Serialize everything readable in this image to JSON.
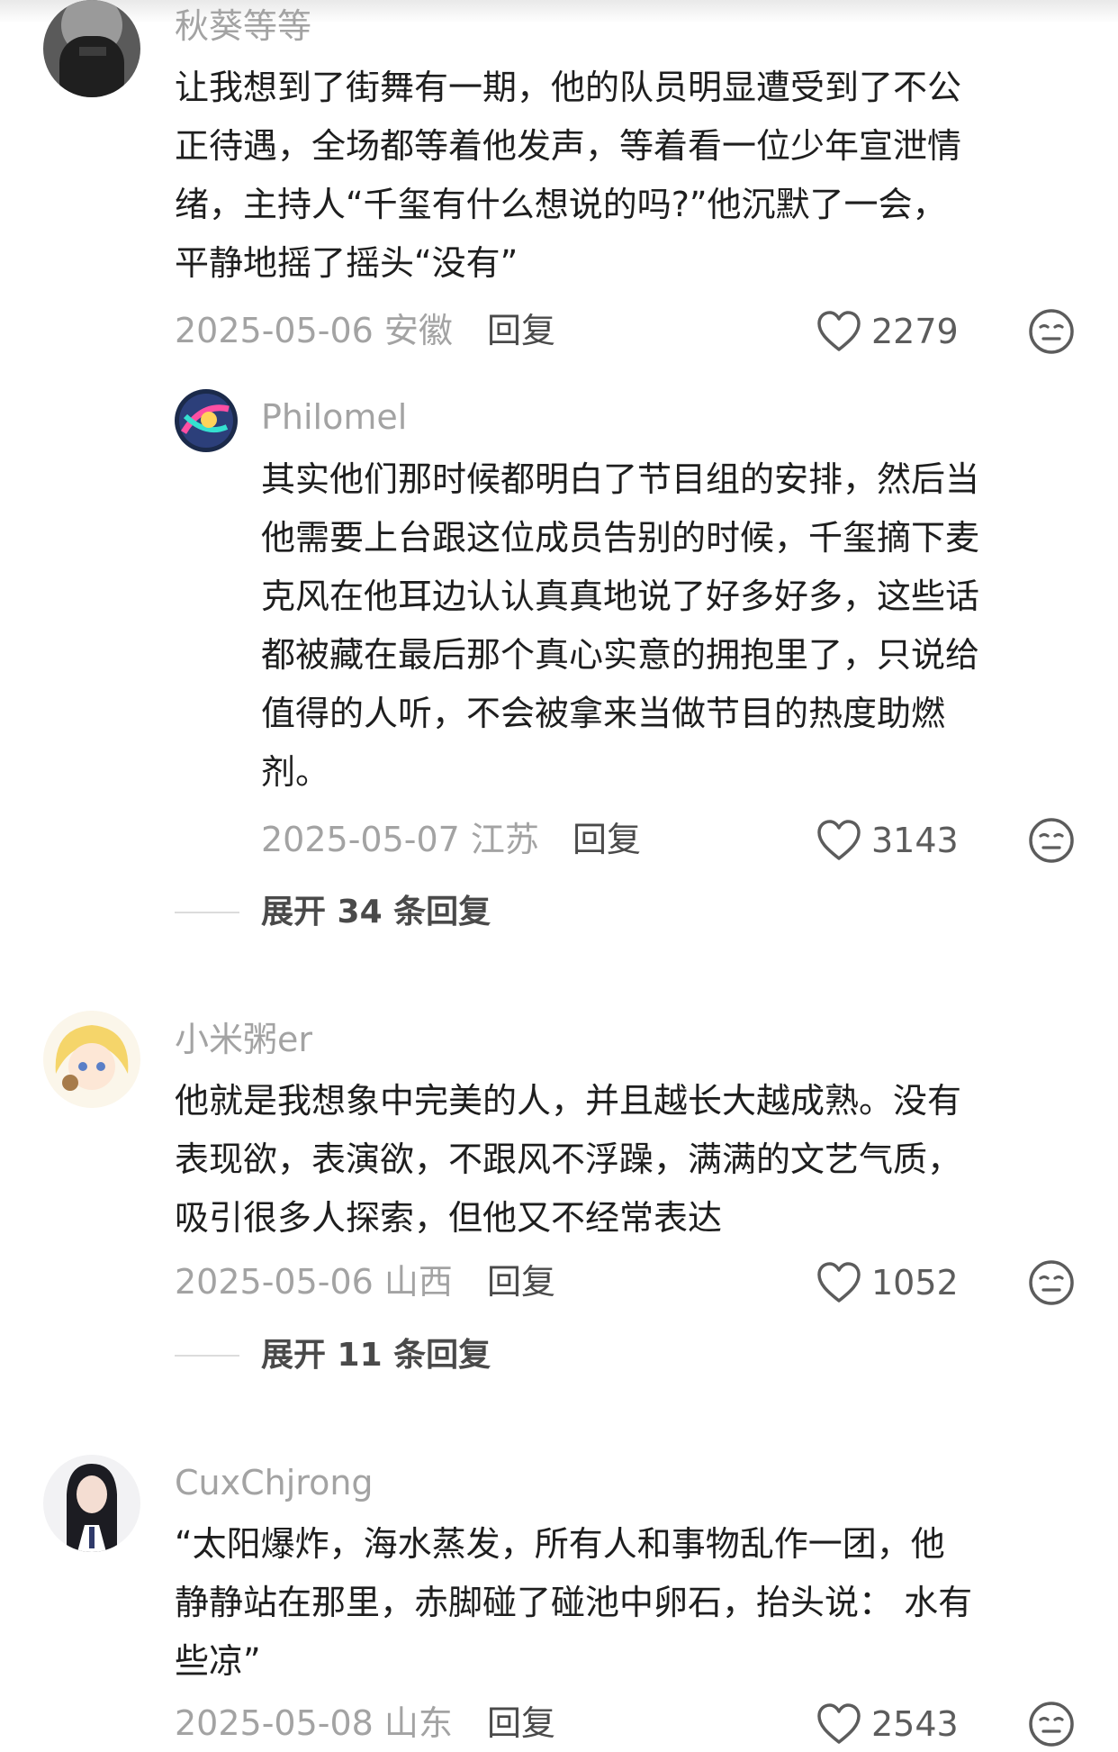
{
  "comments": [
    {
      "username": "秋葵等等",
      "text_lines": [
        "让我想到了街舞有一期，他的队员明显遭受到了不公",
        "正待遇，全场都等着他发声，等着看一位少年宣泄情",
        "绪，主持人“千玺有什么想说的吗?”他沉默了一会，",
        "平静地摇了摇头“没有”"
      ],
      "date": "2025-05-06 安徽",
      "reply_label": "回复",
      "likes": "2279",
      "replies": [
        {
          "username": "Philomel",
          "text_lines": [
            "其实他们那时候都明白了节目组的安排，然后当",
            "他需要上台跟这位成员告别的时候，千玺摘下麦",
            "克风在他耳边认认真真地说了好多好多，这些话",
            "都被藏在最后那个真心实意的拥抱里了，只说给",
            "值得的人听，不会被拿来当做节目的热度助燃",
            "剂。"
          ],
          "date": "2025-05-07 江苏",
          "reply_label": "回复",
          "likes": "3143"
        }
      ],
      "expand_label": "展开 34 条回复"
    },
    {
      "username": "小米粥er",
      "text_lines": [
        "他就是我想象中完美的人，并且越长大越成熟。没有",
        "表现欲，表演欲，不跟风不浮躁，满满的文艺气质，",
        "吸引很多人探索，但他又不经常表达"
      ],
      "date": "2025-05-06 山西",
      "reply_label": "回复",
      "likes": "1052",
      "expand_label": "展开 11 条回复"
    },
    {
      "username": "CuxChjrong",
      "text_lines": [
        "“太阳爆炸，海水蒸发，所有人和事物乱作一团，他",
        "静静站在那里，赤脚碰了碰池中卵石，抬头说： 水有",
        "些凉”"
      ],
      "date": "2025-05-08 山东",
      "reply_label": "回复",
      "likes": "2543"
    }
  ],
  "icons": {
    "like": "heart-outline-icon",
    "reaction": "neutral-face-icon"
  },
  "colors": {
    "meta_gray": "#a3a3a3",
    "text": "#1e1e1e",
    "icon": "#5c5c5c"
  }
}
